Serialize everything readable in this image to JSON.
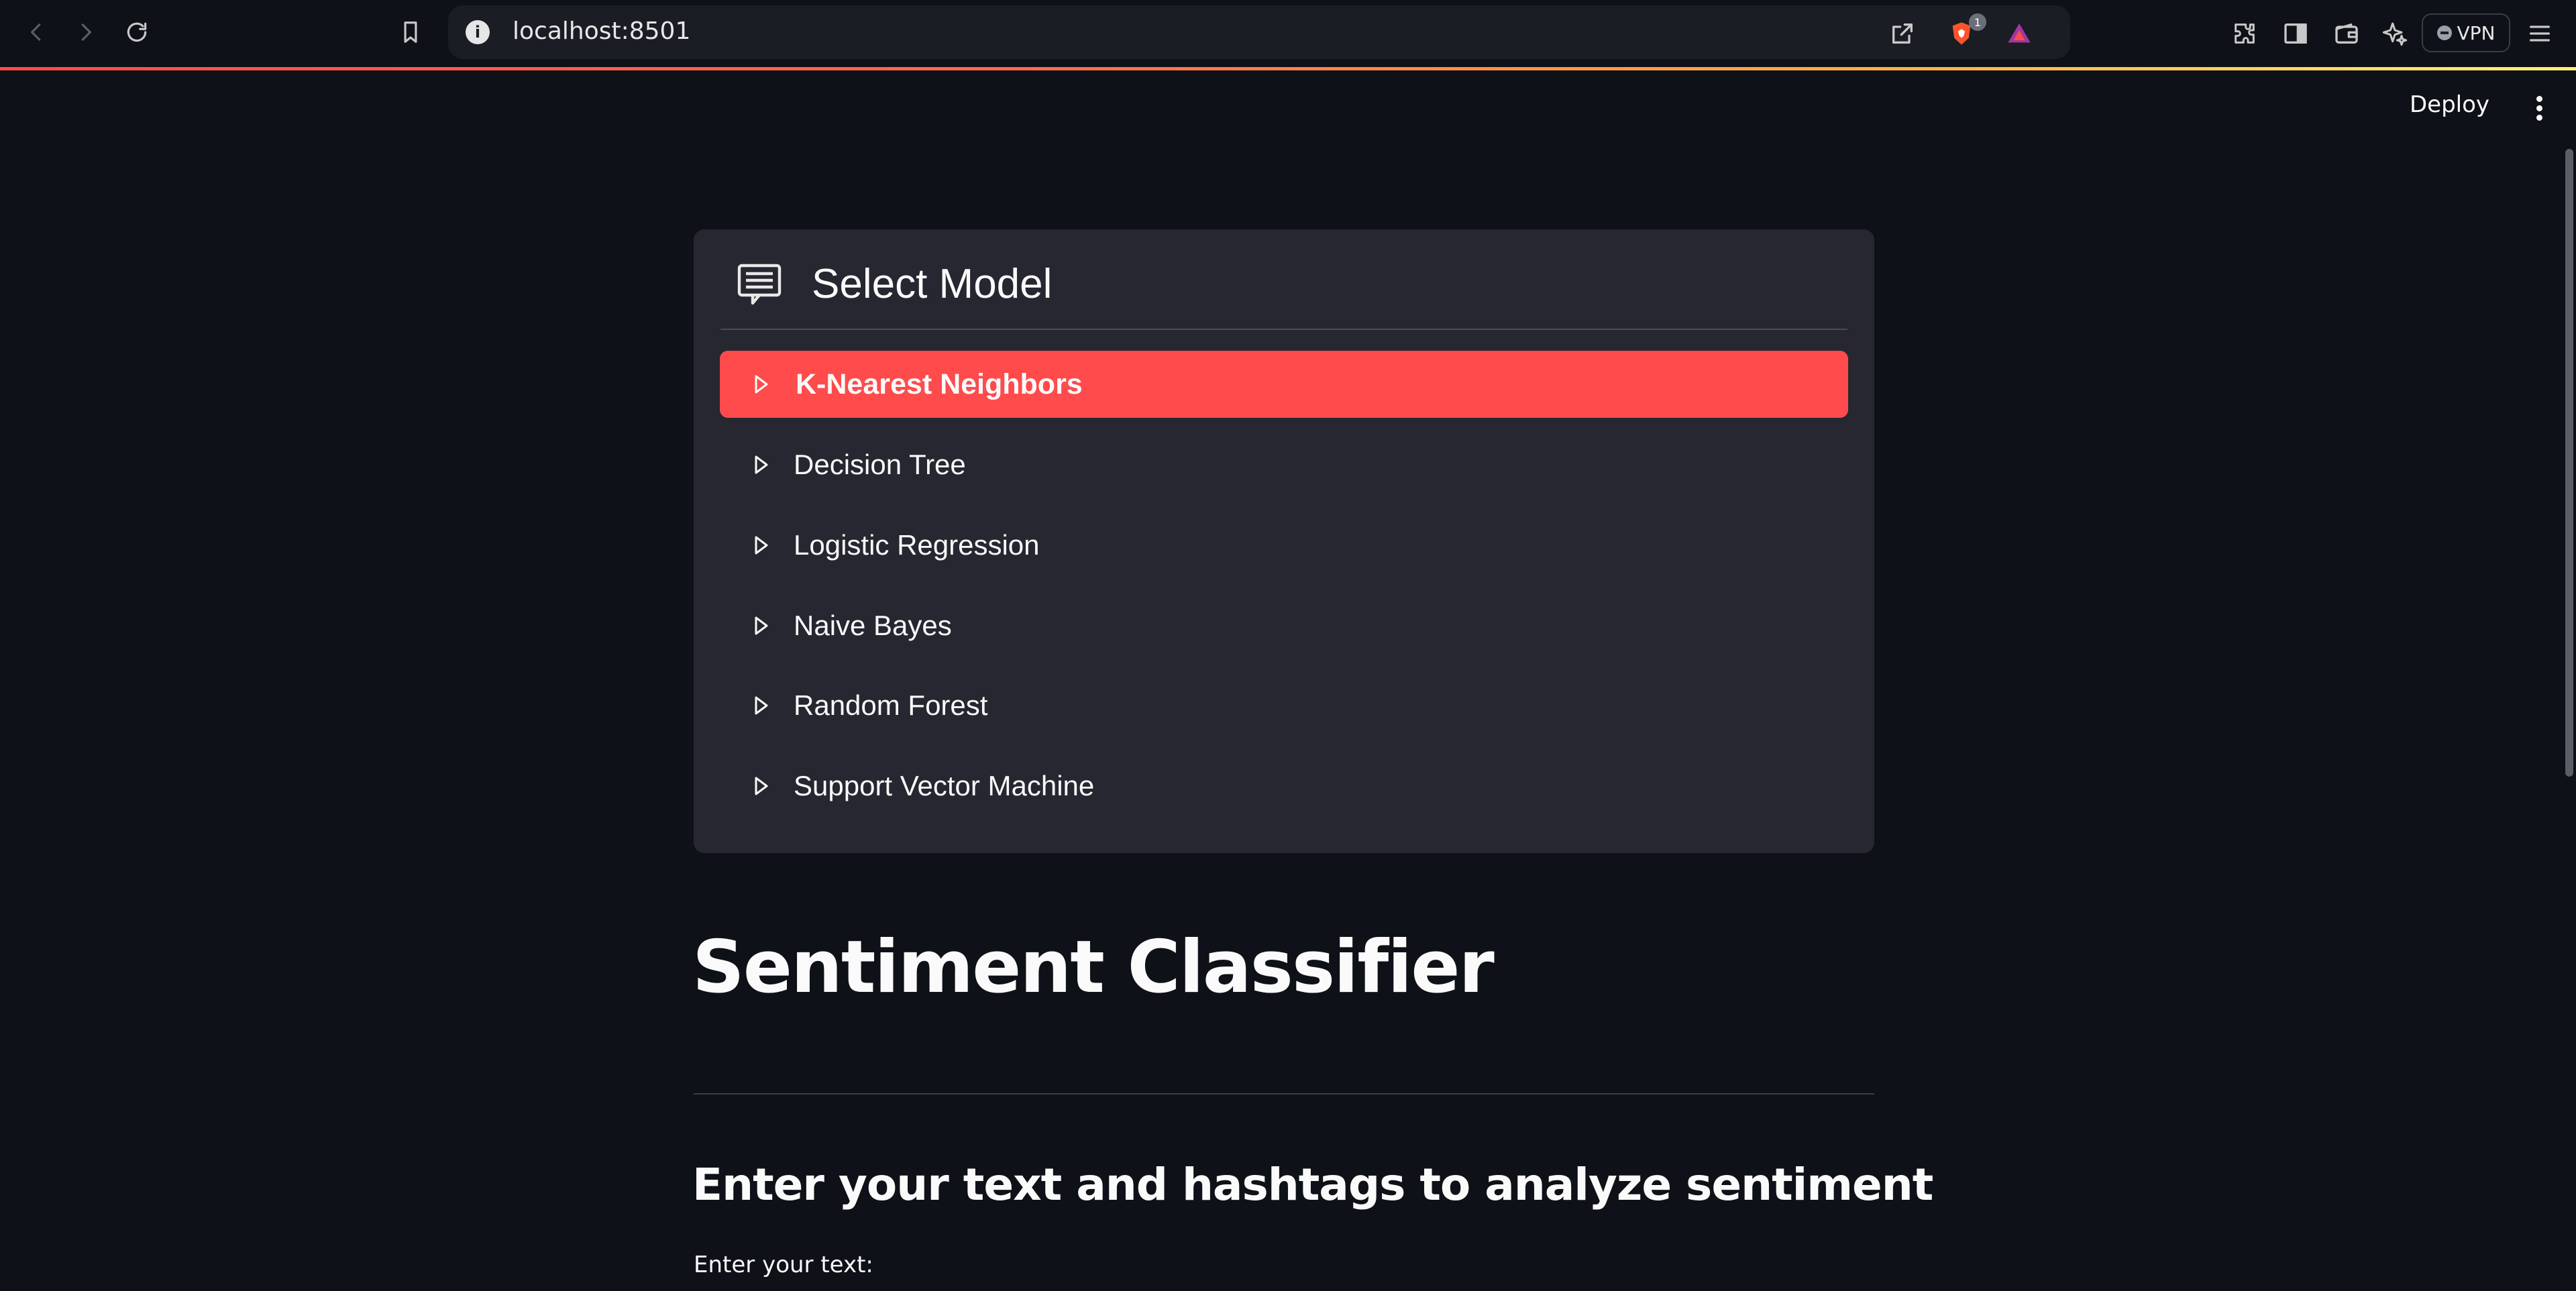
{
  "browser": {
    "url": "localhost:8501",
    "info_symbol": "i",
    "shields_count": "1",
    "vpn_label": "VPN"
  },
  "app_header": {
    "deploy_label": "Deploy"
  },
  "model_menu": {
    "title": "Select Model",
    "items": [
      {
        "label": "K-Nearest Neighbors",
        "selected": true
      },
      {
        "label": "Decision Tree",
        "selected": false
      },
      {
        "label": "Logistic Regression",
        "selected": false
      },
      {
        "label": "Naive Bayes",
        "selected": false
      },
      {
        "label": "Random Forest",
        "selected": false
      },
      {
        "label": "Support Vector Machine",
        "selected": false
      }
    ]
  },
  "main": {
    "title": "Sentiment Classifier",
    "subtitle": "Enter your text and hashtags to analyze sentiment",
    "text_input_label": "Enter your text:"
  },
  "colors": {
    "background": "#0e1117",
    "card": "#262730",
    "accent": "#ff4b4b",
    "text": "#fafafa"
  },
  "icons": {
    "back": "arrow-left-icon",
    "forward": "arrow-right-icon",
    "reload": "reload-icon",
    "bookmark": "bookmark-icon",
    "share": "share-icon",
    "shields": "brave-shields-icon",
    "rewards": "brave-rewards-icon",
    "extensions": "puzzle-icon",
    "sidebar": "sidebar-icon",
    "wallet": "wallet-icon",
    "leo": "sparkle-icon",
    "menu": "hamburger-icon",
    "menu_header": "list-icon",
    "menu_item": "triangle-right-icon"
  }
}
